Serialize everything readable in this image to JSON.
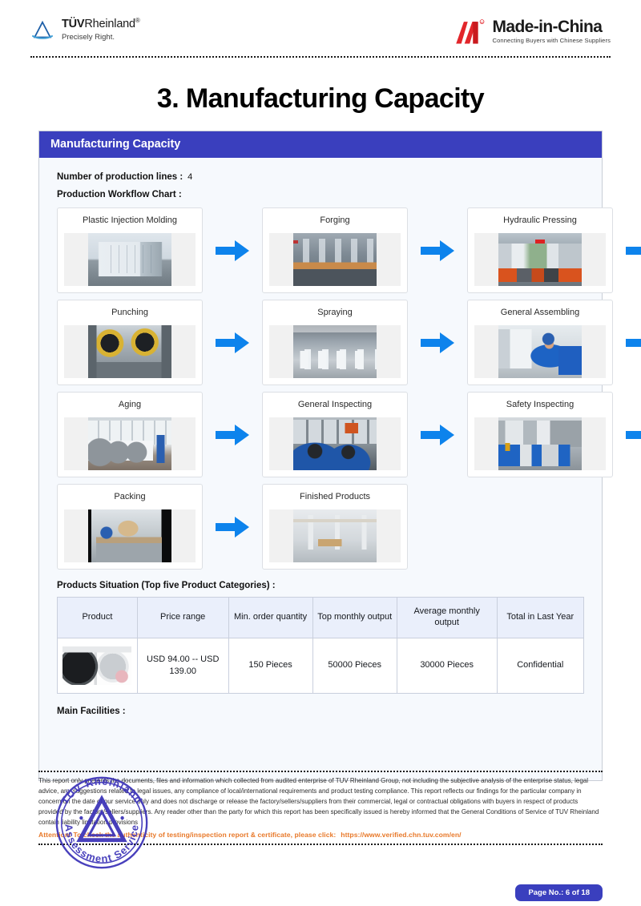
{
  "header": {
    "tuv": {
      "name_bold": "TÜV",
      "name_rest": "Rheinland",
      "registered": "®",
      "tagline": "Precisely Right."
    },
    "mic": {
      "name": "Made-in-China",
      "registered": "®",
      "tagline": "Connecting Buyers with Chinese Suppliers"
    }
  },
  "title": "3. Manufacturing Capacity",
  "panel": {
    "header": "Manufacturing Capacity",
    "production_lines_label": "Number of production lines :",
    "production_lines_value": "4",
    "workflow_label": "Production Workflow Chart :",
    "products_caption": "Products Situation (Top five Product Categories) :",
    "facilities_label": "Main Facilities :"
  },
  "workflow": {
    "steps": [
      {
        "label": "Plastic Injection Molding",
        "photo": "injection-molding-machine"
      },
      {
        "label": "Forging",
        "photo": "forging-press-line"
      },
      {
        "label": "Hydraulic Pressing",
        "photo": "hydraulic-press-shop"
      },
      {
        "label": "Punching",
        "photo": "punching-machines"
      },
      {
        "label": "Spraying",
        "photo": "spraying-line"
      },
      {
        "label": "General Assembling",
        "photo": "assembly-line-worker"
      },
      {
        "label": "Aging",
        "photo": "aging-room-washers"
      },
      {
        "label": "General Inspecting",
        "photo": "inspection-workers"
      },
      {
        "label": "Safety Inspecting",
        "photo": "safety-inspection-station"
      },
      {
        "label": "Packing",
        "photo": "packing-conveyor"
      },
      {
        "label": "Finished Products",
        "photo": "finished-goods-warehouse"
      }
    ]
  },
  "products_table": {
    "columns": [
      "Product",
      "Price range",
      "Min. order quantity",
      "Top monthly output",
      "Average monthly output",
      "Total in Last Year"
    ],
    "rows": [
      {
        "product_photo": "washing-machines",
        "price_range": "USD 94.00 -- USD 139.00",
        "min_order_quantity": "150 Pieces",
        "top_monthly_output": "50000 Pieces",
        "average_monthly_output": "30000 Pieces",
        "total_last_year": "Confidential"
      }
    ]
  },
  "footer": {
    "disclaimer": "This report only presents the documents, files and information which collected from audited enterprise of TUV Rheinland Group, not including the subjective analysis of the enterprise status, legal advice, any suggestions related to legal issues, any compliance of local/international requirements and product testing compliance. This report reflects our findings for the particular company in concern on the date of our service only and does not discharge or release the factory/sellers/suppliers from their commercial, legal or contractual obligations with buyers in respect of products provided by the factory/sellers/suppliers. Any reader other than the party for which this report has been specifically issued is hereby informed that the General Conditions of Service of TUV Rheinland contain liability limitation provisions",
    "attention": "Attention: To check the authenticity of testing/inspection report & certificate, please click:",
    "attention_url": "https://www.verified.chn.tuv.com/en/",
    "page_number": "Page No.: 6 of 18"
  },
  "stamp": {
    "outer_text_top": "TÜV Rheinland",
    "outer_text_bottom": "Assessment Service",
    "color": "#3b32b8"
  },
  "colors": {
    "panel_header": "#3a3fbe",
    "arrow_blue": "#0d83ec",
    "table_header_bg": "#eaeffb",
    "attention_orange": "#e8792a",
    "panel_bg": "#f6f9fd"
  }
}
